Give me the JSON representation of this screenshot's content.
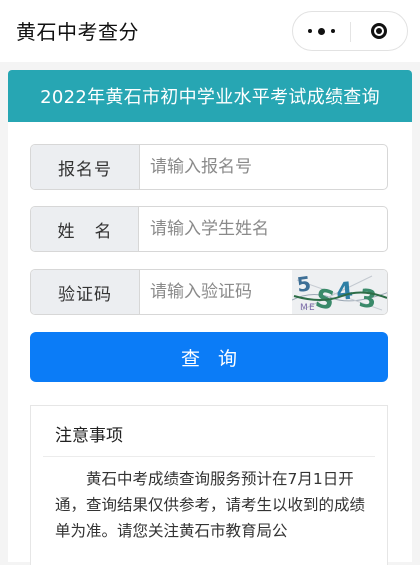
{
  "navbar": {
    "title": "黄石中考查分",
    "more_icon": "more-dots-icon",
    "close_icon": "close-target-icon"
  },
  "banner": {
    "title": "2022年黄石市初中学业水平考试成绩查询",
    "color": "#27a6b3"
  },
  "form": {
    "exam_number": {
      "label": "报名号",
      "placeholder": "请输入报名号"
    },
    "name": {
      "label": "姓名",
      "placeholder": "请输入学生姓名"
    },
    "captcha": {
      "label": "验证码",
      "placeholder": "请输入验证码",
      "image_text": "5S43",
      "image_noise": "ME"
    },
    "submit_label": "查询",
    "submit_color": "#0b7cf7"
  },
  "notice": {
    "title": "注意事项",
    "body": "黄石中考成绩查询服务预计在7月1日开通，查询结果仅供参考，请考生以收到的成绩单为准。请您关注黄石市教育局公"
  }
}
